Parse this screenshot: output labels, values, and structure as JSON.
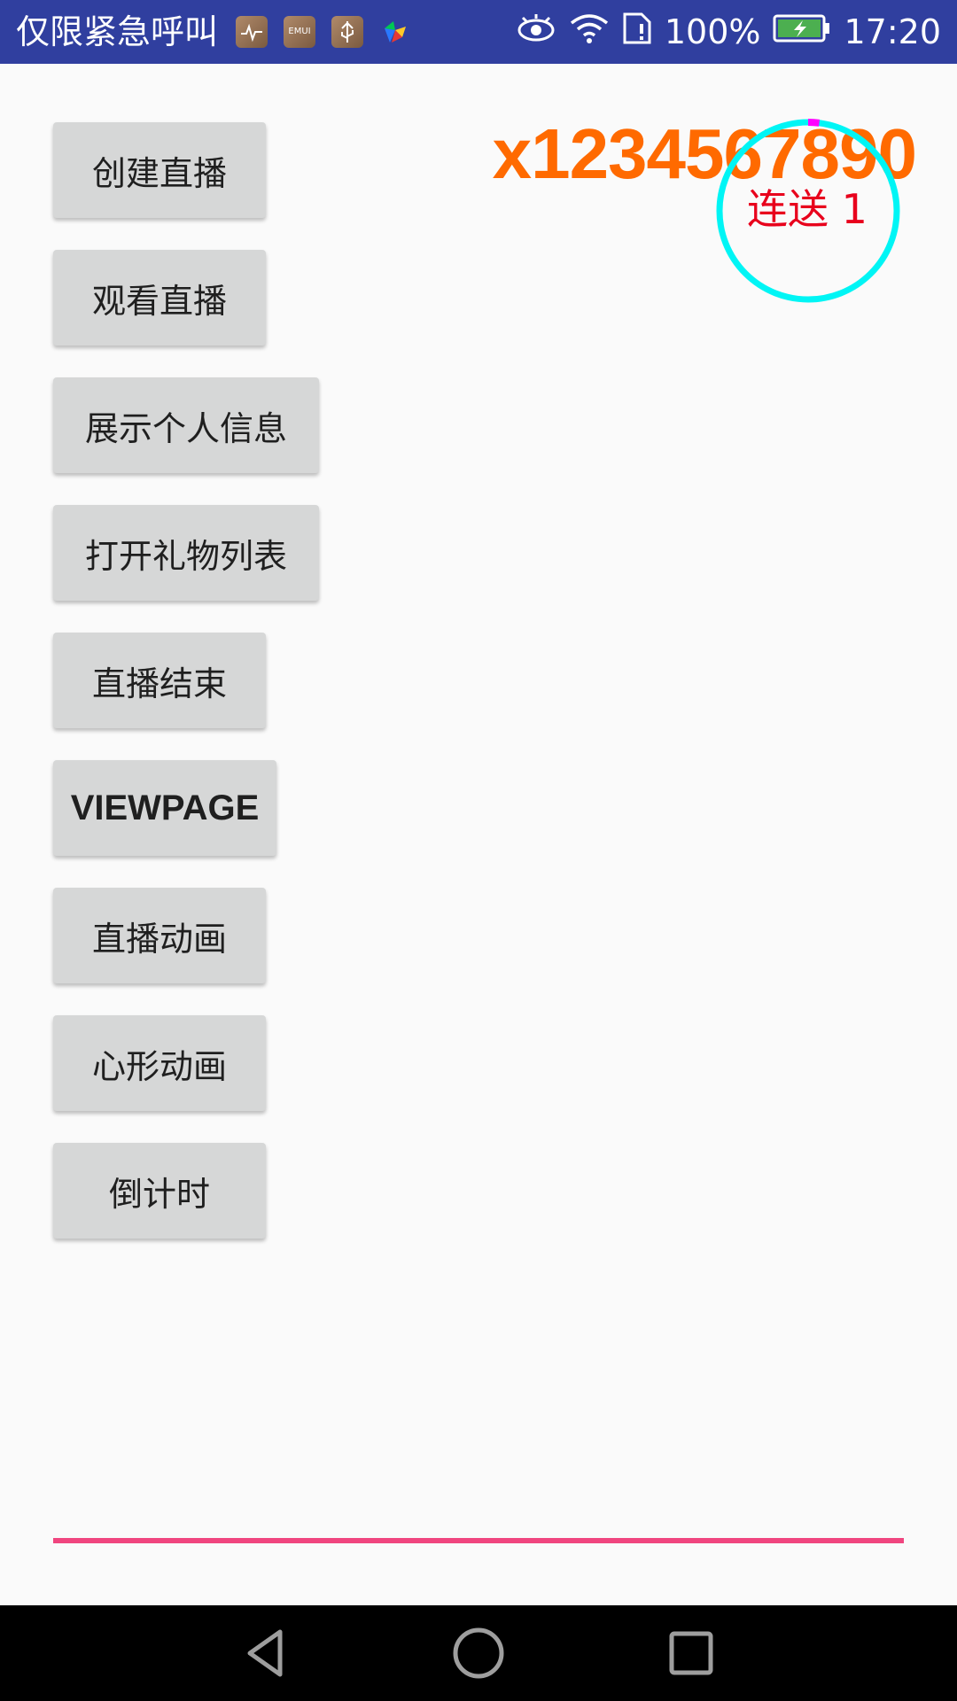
{
  "status_bar": {
    "carrier_text": "仅限紧急呼叫",
    "battery_percent": "100%",
    "time": "17:20",
    "icons": [
      "health-icon",
      "emui-icon",
      "usb-icon",
      "puzzle-icon",
      "eye-icon",
      "wifi-icon",
      "sim-icon",
      "battery-charging-icon"
    ]
  },
  "buttons": {
    "create_live": "创建直播",
    "watch_live": "观看直播",
    "show_profile": "展示个人信息",
    "open_gift_list": "打开礼物列表",
    "end_live": "直播结束",
    "viewpage": "VIEWPAGE",
    "live_animation": "直播动画",
    "heart_animation": "心形动画",
    "countdown": "倒计时"
  },
  "gift": {
    "count_text": "x1234567890",
    "combo_label": "连送 1",
    "progress_fraction": 0.02
  },
  "colors": {
    "status_bar": "#303f9f",
    "button_bg": "#d6d7d7",
    "gift_count": "#ff6a00",
    "ring": "#00f5f5",
    "ring_progress": "#ff00ff",
    "combo_label": "#e8001c",
    "divider": "#f0457f"
  },
  "nav_bar": {
    "icons": [
      "back-icon",
      "home-icon",
      "recents-icon"
    ]
  }
}
